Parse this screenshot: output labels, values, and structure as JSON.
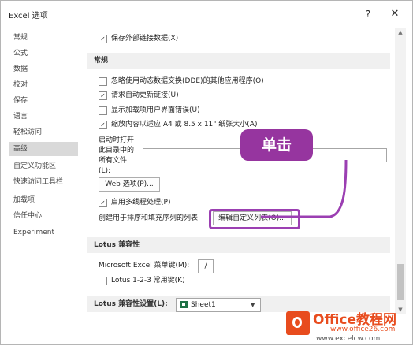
{
  "window": {
    "title": "Excel 选项",
    "help": "?",
    "close": "✕"
  },
  "sidebar": {
    "items": [
      {
        "label": "常规"
      },
      {
        "label": "公式"
      },
      {
        "label": "数据"
      },
      {
        "label": "校对"
      },
      {
        "label": "保存"
      },
      {
        "label": "语言"
      },
      {
        "label": "轻松访问"
      },
      {
        "label": "高级"
      },
      {
        "label": "自定义功能区"
      },
      {
        "label": "快速访问工具栏"
      },
      {
        "label": "加载项"
      },
      {
        "label": "信任中心"
      },
      {
        "label": "Experiment"
      }
    ],
    "active": "高级"
  },
  "content": {
    "save_external": {
      "label": "保存外部链接数据(X)",
      "checked": true
    },
    "general_header": "常规",
    "general": [
      {
        "label": "忽略使用动态数据交换(DDE)的其他应用程序(O)",
        "checked": false
      },
      {
        "label": "请求自动更新链接(U)",
        "checked": true
      },
      {
        "label": "显示加载项用户界面错误(U)",
        "checked": false
      },
      {
        "label": "缩放内容以适应 A4 或 8.5 x 11\" 纸张大小(A)",
        "checked": true
      }
    ],
    "startup_label_1": "启动时打开",
    "startup_label_2": "此目录中的",
    "startup_label_3": "所有文件",
    "startup_label_4": "(L):",
    "startup_value": "",
    "web_options_button": "Web 选项(P)...",
    "multithread": {
      "label": "启用多线程处理(P)",
      "checked": true
    },
    "custom_lists_label": "创建用于排序和填充序列的列表:",
    "edit_custom_lists_button": "编辑自定义列表(O)...",
    "lotus_header": "Lotus 兼容性",
    "menu_key_label": "Microsoft Excel 菜单键(M):",
    "menu_key_value": "/",
    "lotus_keys": {
      "label": "Lotus 1-2-3 常用键(K)",
      "checked": false
    },
    "lotus_settings_label": "Lotus 兼容性设置(L):",
    "lotus_settings_value": "Sheet1"
  },
  "annotation": {
    "callout_text": "单击",
    "color": "#96359f"
  },
  "watermark": {
    "title": "Office教程网",
    "url1": "www.office26.com",
    "url2": "www.excelcw.com",
    "color": "#e84c1e"
  },
  "icons": {
    "check": "✓",
    "dropdown_arrow": "▼",
    "scroll_up": "▲",
    "scroll_down": "▼"
  }
}
